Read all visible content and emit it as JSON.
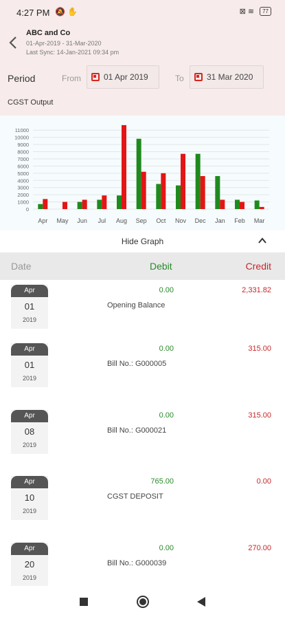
{
  "status_bar": {
    "time": "4:27 PM",
    "left_icons": "🔕 ✋",
    "right_icons": "⊠ ≋",
    "battery": "77"
  },
  "header": {
    "company": "ABC and Co",
    "date_range": "01-Apr-2019 - 31-Mar-2020",
    "last_sync": "Last Sync: 14-Jan-2021 09:34 pm"
  },
  "period": {
    "label": "Period",
    "from_label": "From",
    "from_value": "01 Apr 2019",
    "to_label": "To",
    "to_value": "31 Mar 2020"
  },
  "report_title": "CGST Output",
  "chart_data": {
    "type": "bar",
    "categories": [
      "Apr",
      "May",
      "Jun",
      "Jul",
      "Aug",
      "Sep",
      "Oct",
      "Nov",
      "Dec",
      "Jan",
      "Feb",
      "Mar"
    ],
    "y_ticks": [
      "0",
      "1000",
      "2000",
      "3000",
      "4000",
      "5000",
      "6000",
      "7000",
      "8000",
      "9000",
      "10000",
      "11000"
    ],
    "ylim": [
      0,
      11500
    ],
    "series": [
      {
        "color": "#1e8a1e",
        "values": [
          700,
          0,
          1000,
          1300,
          1900,
          9800,
          3500,
          3300,
          7700,
          4600,
          1300,
          1200
        ]
      },
      {
        "color": "#e31515",
        "values": [
          1400,
          1000,
          1300,
          1900,
          11700,
          5200,
          5000,
          7700,
          4600,
          1300,
          1000,
          300
        ]
      }
    ],
    "grid": true
  },
  "graph_toggle": {
    "label": "Hide Graph"
  },
  "table_header": {
    "date": "Date",
    "debit": "Debit",
    "credit": "Credit"
  },
  "transactions": [
    {
      "month": "Apr",
      "day": "01",
      "year": "2019",
      "debit": "0.00",
      "credit": "2,331.82",
      "description": "Opening Balance"
    },
    {
      "month": "Apr",
      "day": "01",
      "year": "2019",
      "debit": "0.00",
      "credit": "315.00",
      "description": "Bill No.: G000005"
    },
    {
      "month": "Apr",
      "day": "08",
      "year": "2019",
      "debit": "0.00",
      "credit": "315.00",
      "description": "Bill No.: G000021"
    },
    {
      "month": "Apr",
      "day": "10",
      "year": "2019",
      "debit": "765.00",
      "credit": "0.00",
      "description": "CGST DEPOSIT"
    },
    {
      "month": "Apr",
      "day": "20",
      "year": "2019",
      "debit": "0.00",
      "credit": "270.00",
      "description": "Bill No.: G000039"
    }
  ]
}
